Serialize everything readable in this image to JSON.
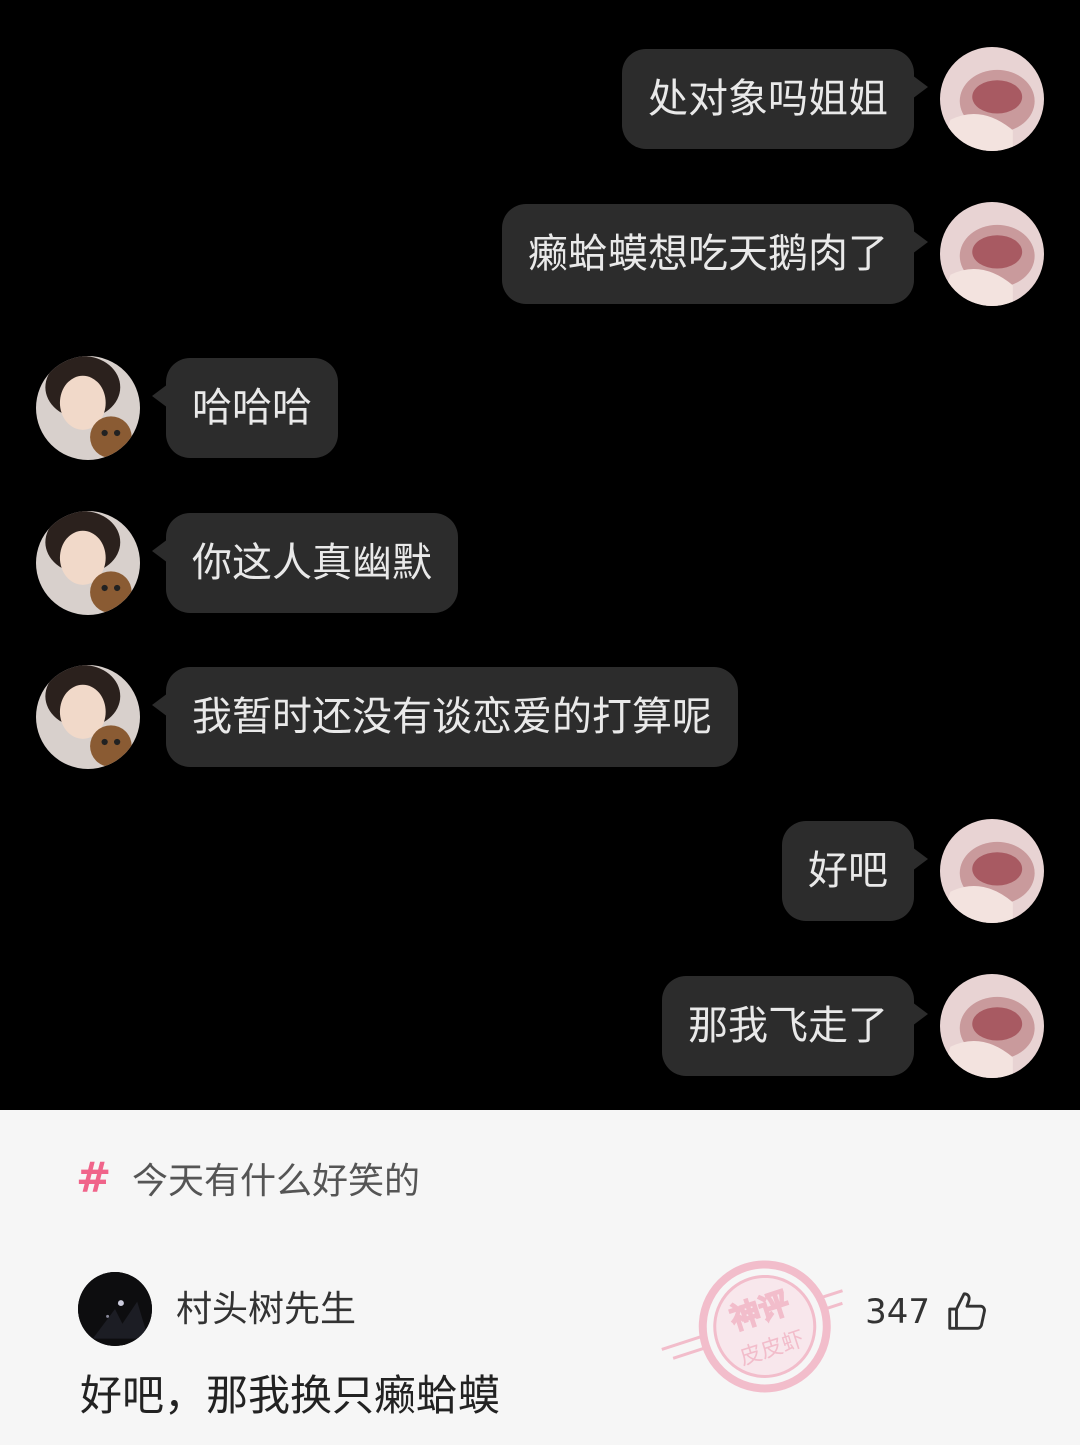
{
  "messages": [
    {
      "side": "right",
      "text": "处对象吗姐姐"
    },
    {
      "side": "right",
      "text": "癞蛤蟆想吃天鹅肉了"
    },
    {
      "side": "left",
      "text": "哈哈哈"
    },
    {
      "side": "left",
      "text": "你这人真幽默"
    },
    {
      "side": "left",
      "text": "我暂时还没有谈恋爱的打算呢"
    },
    {
      "side": "right",
      "text": "好吧"
    },
    {
      "side": "right",
      "text": "那我飞走了"
    }
  ],
  "topic": {
    "hash": "#",
    "text": "今天有什么好笑的"
  },
  "comment": {
    "username": "村头树先生",
    "likes": "347",
    "text": "好吧，那我换只癞蛤蟆"
  },
  "watermark": {
    "line1": "神评",
    "line2": "皮皮虾"
  },
  "colors": {
    "chat_bg": "#000000",
    "bubble": "#2c2c2c",
    "accent": "#f0648a"
  }
}
